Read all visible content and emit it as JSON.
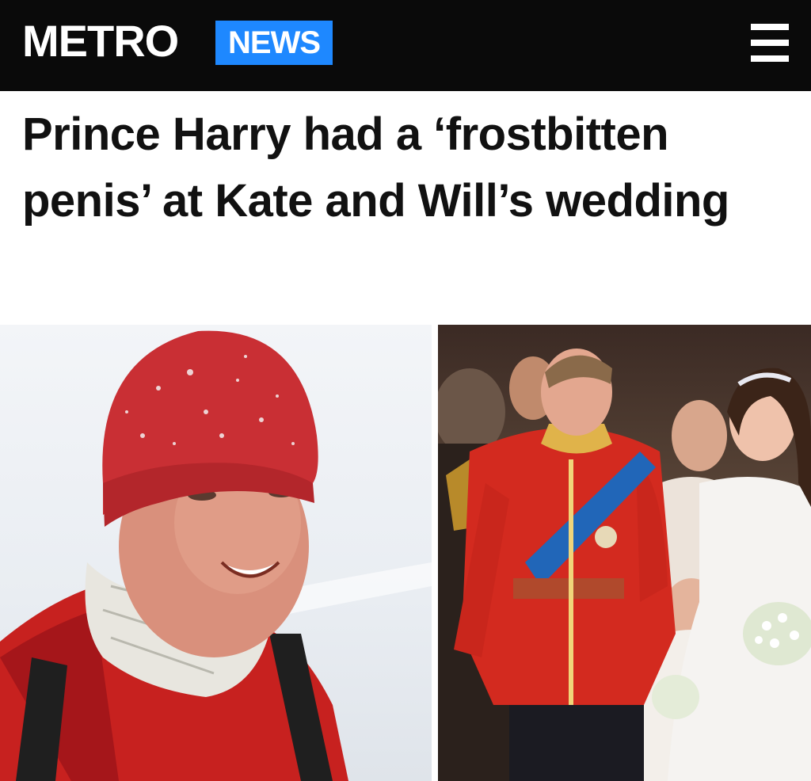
{
  "header": {
    "logo_text": "METRO",
    "section_label": "NEWS",
    "menu_icon": "hamburger-menu-icon",
    "colors": {
      "bar": "#0a0a0a",
      "badge": "#1e88ff"
    }
  },
  "article": {
    "headline": "Prince Harry had a ‘frostbitten penis’ at Kate and Will’s wedding"
  },
  "images": [
    {
      "name": "harry-in-snow-photo"
    },
    {
      "name": "royal-wedding-photo"
    }
  ]
}
